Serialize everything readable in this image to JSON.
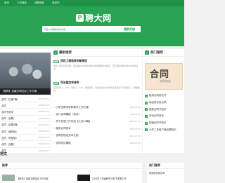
{
  "nav": {
    "items": [
      "首页",
      "工作报告",
      "述职报告",
      "承诺书"
    ]
  },
  "logo": {
    "mark": "P",
    "text": "聘大网"
  },
  "search": {
    "placeholder": "请输入你要搜索的内容",
    "button": "搜索文档"
  },
  "feature": {
    "caption": "【推荐】创建文明社区工作方案"
  },
  "left_list": [
    {
      "title": "合同（汇编7篇）",
      "date": "2023-07-02"
    },
    {
      "title": "合同",
      "date": "2023-07-02"
    },
    {
      "title": "合同书范本",
      "date": "2023-07-02"
    },
    {
      "title": "合同（合集）",
      "date": "2023-07-02"
    },
    {
      "title": "合同（合集5篇）",
      "date": "2023-07-02"
    },
    {
      "title": "合同（通用版）",
      "date": "2023-07-02"
    },
    {
      "title": "合同（完整版）",
      "date": "2023-07-02"
    },
    {
      "title": "合同（合集）",
      "date": "2023-07-02"
    },
    {
      "title": "合同",
      "date": "2023-07-02"
    }
  ],
  "center": {
    "title": "最新推荐",
    "articles": [
      {
        "tag": "推荐",
        "headline": "项目工程验收的新规定",
        "body": "随着工程项目的实施，越来越多的项目在验收时需要遵循新的规定，而工程的验收标准也在逐步提高。"
      },
      {
        "tag": "推荐",
        "headline": "司法鉴定申请书",
        "body": "鉴定申请人：XXX，委托人：XXX。申请事项：请求对该案件中的相关事项进行司法鉴定，以明确事实。"
      }
    ],
    "list": [
      {
        "title": "小学生教学学科教学工作方案",
        "date": "2023-07-02"
      },
      {
        "title": "设计合同模板（范本）",
        "date": "2023-07-02"
      },
      {
        "title": "关于加强工作总结【汇总10篇】",
        "date": "2023-07-02"
      },
      {
        "title": "租房合同范本",
        "date": "2023-07-02"
      },
      {
        "title": "合同的规定范本文档",
        "date": "2023-07-02"
      },
      {
        "title": "合同协议模板",
        "date": "2023-07-02"
      }
    ]
  },
  "right": {
    "title": "热门推荐",
    "image_big": "合同",
    "image_sub": "合同协议",
    "list": [
      "租房合同协议书",
      "商品房买卖合同",
      "借款合同书范本",
      "劳动合同范本",
      "购销合同书范本",
      "小学二年级下册品德知识"
    ]
  },
  "section_title": "范文",
  "bottom_left": {
    "title": "推荐",
    "items": [
      "【精选】创建文明社区工作方案",
      "2023年三年级教学计划下学期工作"
    ]
  },
  "bottom_right": {
    "title": "热门推荐",
    "items": [
      "商品房买卖合同"
    ]
  },
  "colors": {
    "brand": "#2aa454",
    "nav": "#1f9247"
  }
}
